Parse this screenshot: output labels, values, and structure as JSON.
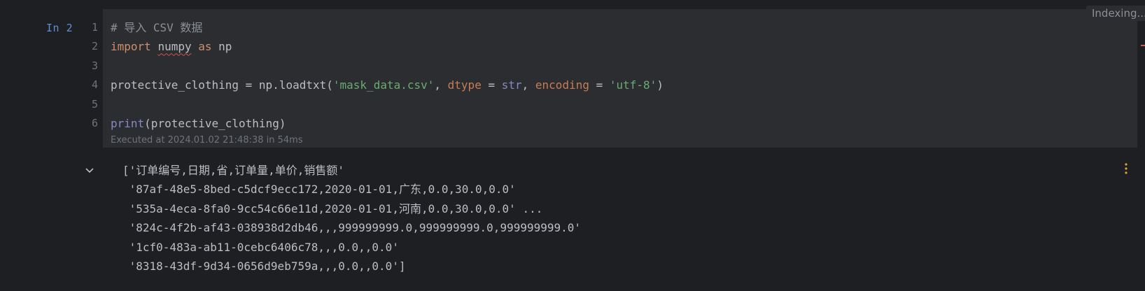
{
  "cell": {
    "prompt": "In 2",
    "line_numbers": [
      "1",
      "2",
      "3",
      "4",
      "5",
      "6"
    ],
    "code": {
      "l1_comment": "# 导入 CSV 数据",
      "l2_import": "import",
      "l2_module": "numpy",
      "l2_as": "as",
      "l2_alias": "np",
      "l4_var": "protective_clothing = np.loadtxt(",
      "l4_file": "'mask_data.csv'",
      "l4_sep1": ", ",
      "l4_dtype": "dtype",
      "l4_eq1": " = ",
      "l4_str": "str",
      "l4_sep2": ", ",
      "l4_encoding": "encoding",
      "l4_eq2": " = ",
      "l4_utf": "'utf-8'",
      "l4_close": ")",
      "l6_print": "print",
      "l6_args": "(protective_clothing)"
    },
    "executed": "Executed at 2024.01.02 21:48:38 in 54ms"
  },
  "status": {
    "indexing": "Indexing..."
  },
  "icons": {
    "collapse": "chevron-down-icon",
    "more": "more-vertical-icon"
  },
  "output_lines": [
    "['订单编号,日期,省,订单量,单价,销售额'",
    " '87af-48e5-8bed-c5dcf9ecc172,2020-01-01,广东,0.0,30.0,0.0'",
    " '535a-4eca-8fa0-9cc54c66e11d,2020-01-01,河南,0.0,30.0,0.0' ...",
    " '824c-4f2b-af43-038938d2db46,,,999999999.0,999999999.0,999999999.0'",
    " '1cf0-483a-ab11-0cebc6406c78,,,0.0,,0.0'",
    " '8318-43df-9d34-0656d9eb759a,,,0.0,,0.0']"
  ],
  "colors": {
    "background": "#1e1f22",
    "cell_background": "#2b2d30",
    "keyword": "#cf8e6d",
    "string": "#6aab73",
    "builtin": "#8888c6",
    "prompt": "#5f8fd6"
  }
}
